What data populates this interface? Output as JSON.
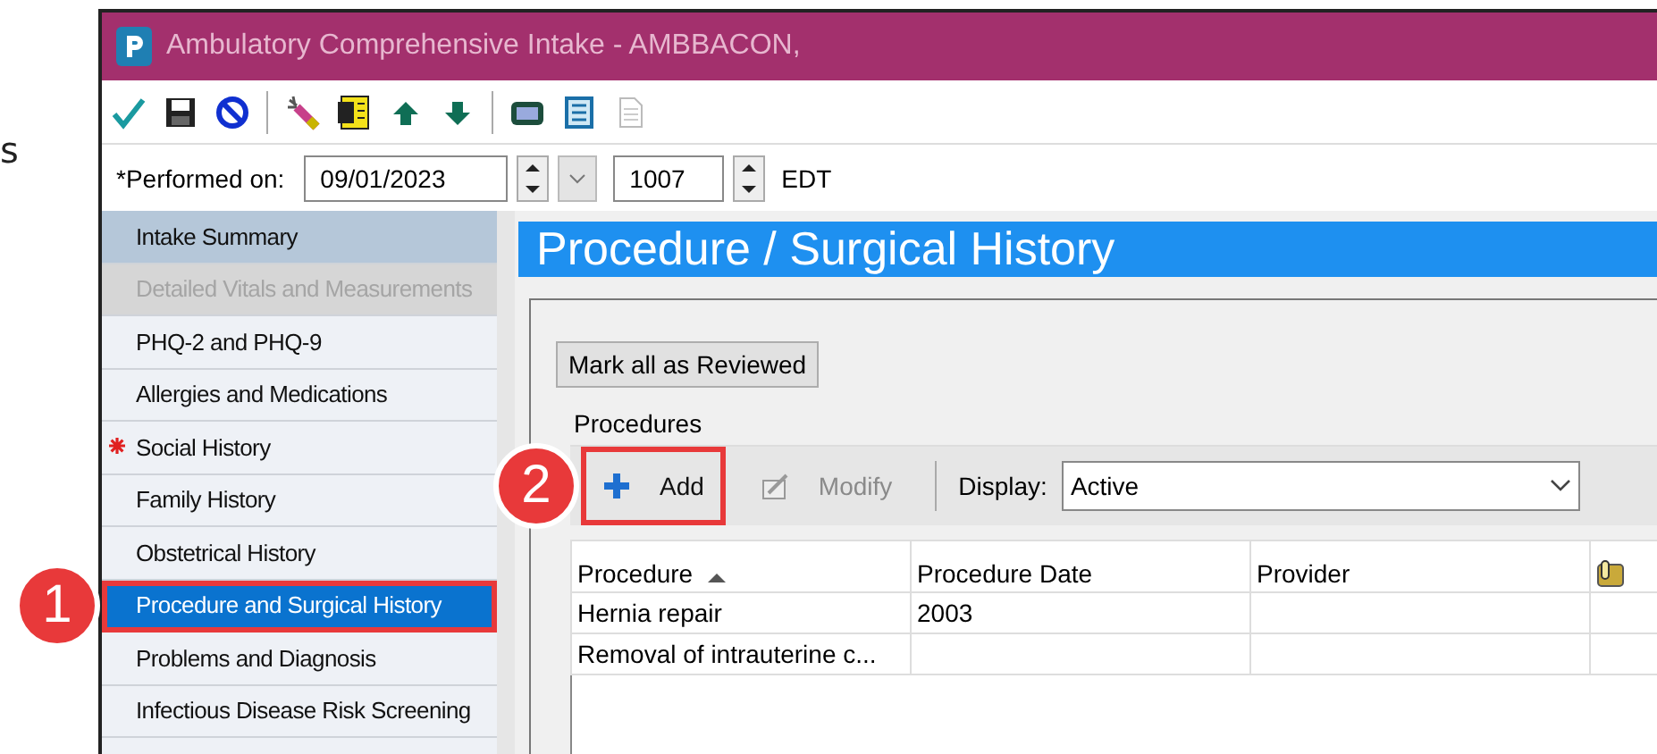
{
  "margin_text": "s",
  "window": {
    "title": "Ambulatory Comprehensive Intake - AMBBACON,"
  },
  "performed": {
    "label": "*Performed on:",
    "date": "09/01/2023",
    "time": "1007",
    "zone": "EDT"
  },
  "sidebar": {
    "items": [
      {
        "label": "Intake Summary",
        "kind": "summary",
        "selected": false,
        "disabled": false,
        "required": false,
        "highlighted": false
      },
      {
        "label": "Detailed Vitals and Measurements",
        "kind": "section",
        "selected": false,
        "disabled": true,
        "required": false,
        "highlighted": false
      },
      {
        "label": "PHQ-2 and PHQ-9",
        "kind": "section",
        "selected": false,
        "disabled": false,
        "required": false,
        "highlighted": false
      },
      {
        "label": "Allergies and Medications",
        "kind": "section",
        "selected": false,
        "disabled": false,
        "required": false,
        "highlighted": false
      },
      {
        "label": "Social History",
        "kind": "section",
        "selected": false,
        "disabled": false,
        "required": true,
        "highlighted": false
      },
      {
        "label": "Family History",
        "kind": "section",
        "selected": false,
        "disabled": false,
        "required": false,
        "highlighted": false
      },
      {
        "label": "Obstetrical History",
        "kind": "section",
        "selected": false,
        "disabled": false,
        "required": false,
        "highlighted": false
      },
      {
        "label": "Procedure and Surgical History",
        "kind": "section",
        "selected": true,
        "disabled": false,
        "required": false,
        "highlighted": true,
        "callout": "1"
      },
      {
        "label": "Problems and Diagnosis",
        "kind": "section",
        "selected": false,
        "disabled": false,
        "required": false,
        "highlighted": false
      },
      {
        "label": "Infectious Disease Risk Screening",
        "kind": "section",
        "selected": false,
        "disabled": false,
        "required": false,
        "highlighted": false
      }
    ]
  },
  "section": {
    "title": "Procedure / Surgical History",
    "review_button": "Mark all as Reviewed",
    "group_label": "Procedures",
    "actions": [
      {
        "label": "Add",
        "kind": "add",
        "disabled": false,
        "highlighted": true,
        "callout": "2"
      },
      {
        "label": "Modify",
        "kind": "modify",
        "disabled": true,
        "highlighted": false
      }
    ],
    "display": {
      "label": "Display:",
      "value": "Active"
    },
    "table": {
      "columns": [
        {
          "label": "Procedure",
          "sorted": true
        },
        {
          "label": "Procedure Date",
          "sorted": false
        },
        {
          "label": "Provider",
          "sorted": false
        }
      ],
      "rows": [
        [
          "Hernia repair",
          "2003",
          ""
        ],
        [
          "Removal of intrauterine c...",
          "",
          ""
        ]
      ]
    }
  }
}
